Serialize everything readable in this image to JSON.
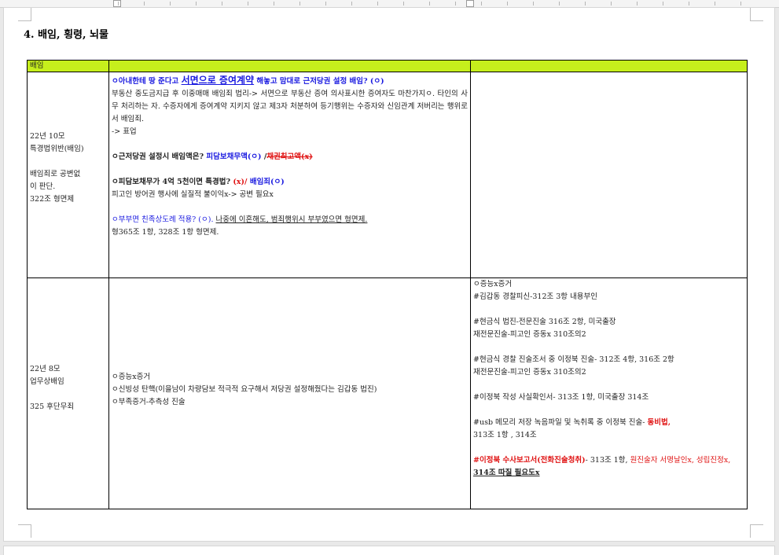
{
  "heading": "4. 배임, 횡령, 뇌물",
  "table": {
    "header": {
      "col1": "배임",
      "col2": "",
      "col3": ""
    },
    "row1": {
      "left": {
        "l1": "22년 10모",
        "l2": "특경법위반(배임)",
        "l3": "배임죄로 공변없",
        "l4": "이 판단.",
        "l5": "322조 형면제"
      },
      "q1": {
        "a": "ㅇ아내한테 땅 준다고 ",
        "b": "서면으로 증여계약",
        "c": " 해놓고 맘대로 근저당권 설정 배임? (ㅇ)"
      },
      "p1": "부동산 중도금지급 후 이중매매 배임죄 법리-> 서면으로 부동산 증여 의사표시한 증여자도 마찬가지ㅇ. 타인의 사무 처리하는 자. 수증자에게 증여계약 지키지 않고 제3자 처분하여 등기행위는 수증자와 신임관계 저버리는 행위로서 배임죄.",
      "p2": "-> 표업",
      "q2": {
        "a": "ㅇ근저당권 설정시 배임액은? ",
        "b": "피담보채무액(ㅇ)",
        "c": " /",
        "d": "채권최고액(x)"
      },
      "q3": {
        "a": "ㅇ피담보채무가 4억 5천이면 특경법? ",
        "b": "(x)/",
        "c": " 배임죄(ㅇ)"
      },
      "p3": "피고인 방어권 행사에 실질적 불이익x-> 공변 필요x",
      "q4": {
        "a": "ㅇ부부면 친족상도례 적용? (ㅇ). ",
        "b": "나중에 이혼해도, 범죄행위시 부부였으면 형면제."
      },
      "p4": "형365조 1항, 328조 1항 형면제."
    },
    "row2": {
      "left": {
        "l1": "22년 8모",
        "l2": "업무상배임",
        "l3": "325 후단무죄"
      },
      "mid": {
        "l1": "ㅇ증능x증거",
        "l2": "ㅇ신빙성 탄핵(이을남이 차량담보 적극적 요구해서 저당권 설정해줬다는 김갑동 법진)",
        "l3": "ㅇ부족증거-추측성 진술"
      },
      "right": {
        "r1": "ㅇ증능x증거",
        "r2": "#김갑동 경찰피신-312조 3항 내용부인",
        "r3": "#현금식 법진-전문진술 316조 2항, 미국출장",
        "r4": "재전문진술-피고인 증동x 310조의2",
        "r5": "#현금식 경찰 진술조서 중 이정북 진술- 312조 4항, 316조 2항",
        "r6": "재전문진술-피고인 증동x 310조의2",
        "r7": "#이정북 작성 사실확인서- 313조 1항, 미국출장 314조",
        "r8a": "#usb 메모리 저장 녹음파일 및 녹취록 중 이정북 진술- ",
        "r8b": "동비법,",
        "r9": "313조 1항 , 314조",
        "r10a": "#이정북 수사보고서(전화진술청취)",
        "r10b": "- 313조 1항, ",
        "r10c": "원진술자 서명날인x, 성립진정x, ",
        "r10d": "314조 따질 필요도x"
      }
    }
  }
}
